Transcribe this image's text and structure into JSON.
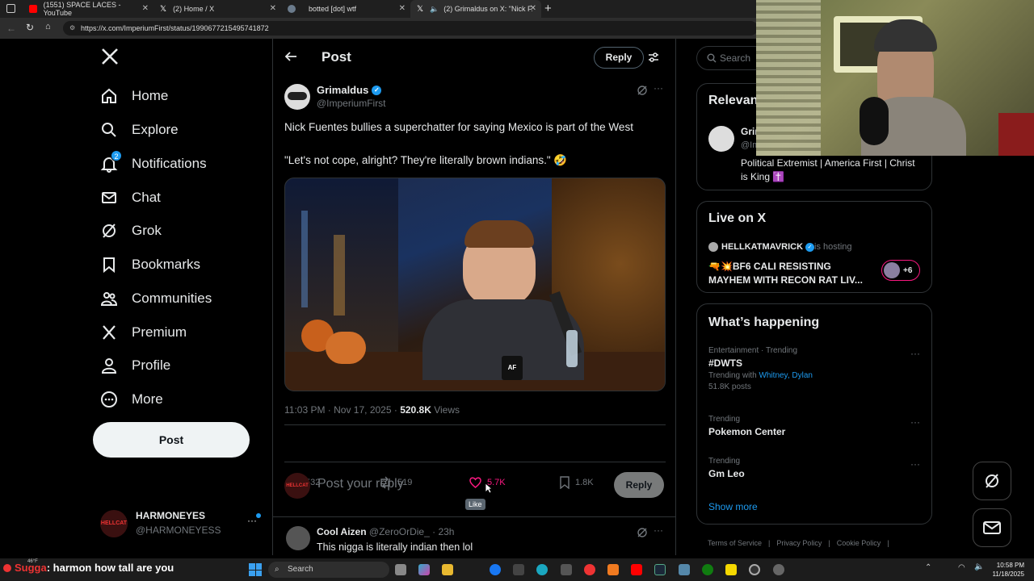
{
  "browser": {
    "tabs": [
      {
        "title": "(1551) SPACE LACES - YouTube",
        "icon": "youtube-icon",
        "color": "#ff0000"
      },
      {
        "title": "(2) Home / X",
        "icon": "x-icon",
        "color": "#ffffff"
      },
      {
        "title": "botted [dot] wtf",
        "icon": "globe-icon",
        "color": "#6b7b8c"
      },
      {
        "title": "(2) Grimaldus on X: \"Nick F...",
        "icon": "x-icon",
        "color": "#ffffff"
      }
    ],
    "new_tab": "+",
    "url": "https://x.com/ImperiumFirst/status/1990677215495741872"
  },
  "sidebar": {
    "items": [
      {
        "label": "Home",
        "icon": "home-icon"
      },
      {
        "label": "Explore",
        "icon": "search-icon"
      },
      {
        "label": "Notifications",
        "icon": "bell-icon",
        "badge": "2"
      },
      {
        "label": "Chat",
        "icon": "mail-icon"
      },
      {
        "label": "Grok",
        "icon": "grok-icon"
      },
      {
        "label": "Bookmarks",
        "icon": "bookmark-icon"
      },
      {
        "label": "Communities",
        "icon": "communities-icon"
      },
      {
        "label": "Premium",
        "icon": "x-icon"
      },
      {
        "label": "Profile",
        "icon": "person-icon"
      },
      {
        "label": "More",
        "icon": "more-circle-icon"
      }
    ],
    "post_button": "Post",
    "account": {
      "name": "HARMONEYES",
      "handle": "@HARMONEYESS",
      "avatar_text": "HELLCAT"
    }
  },
  "header": {
    "title": "Post",
    "reply_button": "Reply"
  },
  "post": {
    "author": "Grimaldus",
    "handle": "@ImperiumFirst",
    "text_line1": "Nick Fuentes bullies a superchatter for saying Mexico is part of the West",
    "text_line2": "\"Let's not cope, alright? They're literally brown indians.\" 🤣",
    "time": "11:03 PM · Nov 17, 2025 · ",
    "views_count": "520.8K",
    "views_label": " Views",
    "replies": "532",
    "reposts": "519",
    "likes": "5.7K",
    "bookmarks": "1.8K",
    "like_tooltip": "Like",
    "mug_text": "AF"
  },
  "reply_box": {
    "placeholder": "Post your reply",
    "button": "Reply",
    "avatar_text": "HELLCAT"
  },
  "reply": {
    "author": "Cool Aizen",
    "handle": "@ZeroOrDie_",
    "time": "· 23h",
    "text": "This nigga is literally indian then lol"
  },
  "right": {
    "search_placeholder": "Search",
    "relevant": {
      "title": "Relevant people",
      "name": "Grimaldus",
      "handle": "@ImperiumFirst",
      "bio": "Political Extremist | America First | Christ is King ✝️"
    },
    "live": {
      "title": "Live on X",
      "host": "HELLKATMAVRICK",
      "hosting": " is hosting",
      "stream_title": "🔫💥BF6 CALI RESISTING MAYHEM WITH RECON RAT LIV...",
      "extra": "+6"
    },
    "happening": {
      "title": "What’s happening",
      "trends": [
        {
          "category": "Entertainment · Trending",
          "name": "#DWTS",
          "with_label": "Trending with ",
          "with_names": "Whitney, Dylan",
          "posts": "51.8K posts"
        },
        {
          "category": "Trending",
          "name": "Pokemon Center"
        },
        {
          "category": "Trending",
          "name": "Gm Leo"
        }
      ],
      "show_more": "Show more"
    },
    "footer": [
      "Terms of Service",
      "Privacy Policy",
      "Cookie Policy"
    ]
  },
  "chat_overlay": {
    "user": "Sugga",
    "message": ": harmon how tall are you",
    "weather": "46°F"
  },
  "taskbar": {
    "search": "Search",
    "time": "10:58 PM",
    "date": "11/18/2025"
  },
  "colors": {
    "accent": "#1d9bf0",
    "like": "#f91880",
    "verified": "#1d9bf0"
  }
}
